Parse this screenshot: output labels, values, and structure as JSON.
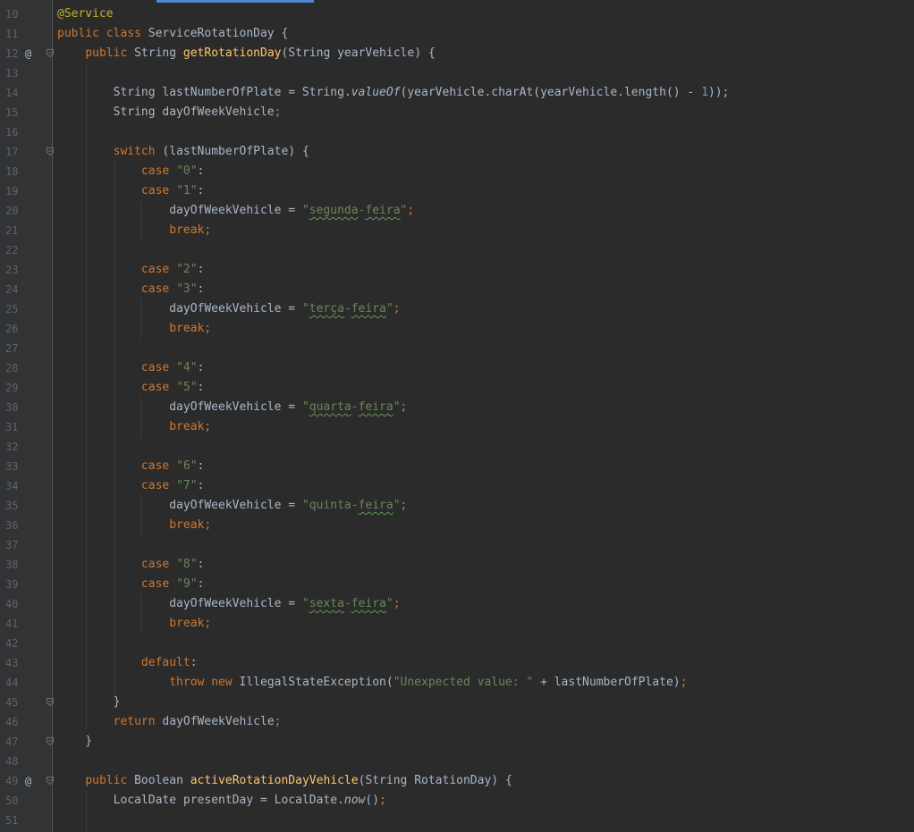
{
  "editor": {
    "lines": [
      {
        "n": "10",
        "segments": [
          {
            "t": "@Service",
            "c": "ann"
          }
        ]
      },
      {
        "n": "11",
        "segments": [
          {
            "t": "public class ",
            "c": "kw"
          },
          {
            "t": "ServiceRotationDay {",
            "c": ""
          }
        ]
      },
      {
        "n": "12",
        "icon": "@",
        "fold": true,
        "segments": [
          {
            "t": "    ",
            "c": ""
          },
          {
            "t": "public ",
            "c": "kw"
          },
          {
            "t": "String ",
            "c": ""
          },
          {
            "t": "getRotationDay",
            "c": "fn"
          },
          {
            "t": "(String yearVehicle) {",
            "c": ""
          }
        ]
      },
      {
        "n": "13",
        "segments": []
      },
      {
        "n": "14",
        "segments": [
          {
            "t": "        String lastNumberOfPlate = String.",
            "c": ""
          },
          {
            "t": "valueOf",
            "c": "ital"
          },
          {
            "t": "(yearVehicle.charAt(yearVehicle.length() - ",
            "c": ""
          },
          {
            "t": "1",
            "c": "num"
          },
          {
            "t": "));",
            "c": ""
          }
        ]
      },
      {
        "n": "15",
        "segments": [
          {
            "t": "        String dayOfWeekVehicle",
            "c": ""
          },
          {
            "t": ";",
            "c": "kw"
          }
        ]
      },
      {
        "n": "16",
        "segments": []
      },
      {
        "n": "17",
        "fold": true,
        "segments": [
          {
            "t": "        ",
            "c": ""
          },
          {
            "t": "switch ",
            "c": "kw"
          },
          {
            "t": "(lastNumberOfPlate) {",
            "c": ""
          }
        ]
      },
      {
        "n": "18",
        "segments": [
          {
            "t": "            ",
            "c": ""
          },
          {
            "t": "case ",
            "c": "kw"
          },
          {
            "t": "\"0\"",
            "c": "str"
          },
          {
            "t": ":",
            "c": ""
          }
        ]
      },
      {
        "n": "19",
        "segments": [
          {
            "t": "            ",
            "c": ""
          },
          {
            "t": "case ",
            "c": "kw"
          },
          {
            "t": "\"1\"",
            "c": "str"
          },
          {
            "t": ":",
            "c": ""
          }
        ]
      },
      {
        "n": "20",
        "segments": [
          {
            "t": "                dayOfWeekVehicle = ",
            "c": ""
          },
          {
            "t": "\"",
            "c": "str"
          },
          {
            "t": "segunda",
            "c": "str typo"
          },
          {
            "t": "-",
            "c": "str"
          },
          {
            "t": "feira",
            "c": "str typo"
          },
          {
            "t": "\"",
            "c": "str"
          },
          {
            "t": ";",
            "c": "kw"
          }
        ]
      },
      {
        "n": "21",
        "segments": [
          {
            "t": "                ",
            "c": ""
          },
          {
            "t": "break;",
            "c": "kw"
          }
        ]
      },
      {
        "n": "22",
        "segments": []
      },
      {
        "n": "23",
        "segments": [
          {
            "t": "            ",
            "c": ""
          },
          {
            "t": "case ",
            "c": "kw"
          },
          {
            "t": "\"2\"",
            "c": "str"
          },
          {
            "t": ":",
            "c": ""
          }
        ]
      },
      {
        "n": "24",
        "segments": [
          {
            "t": "            ",
            "c": ""
          },
          {
            "t": "case ",
            "c": "kw"
          },
          {
            "t": "\"3\"",
            "c": "str"
          },
          {
            "t": ":",
            "c": ""
          }
        ]
      },
      {
        "n": "25",
        "segments": [
          {
            "t": "                dayOfWeekVehicle = ",
            "c": ""
          },
          {
            "t": "\"",
            "c": "str"
          },
          {
            "t": "terça",
            "c": "str typo"
          },
          {
            "t": "-",
            "c": "str"
          },
          {
            "t": "feira",
            "c": "str typo"
          },
          {
            "t": "\"",
            "c": "str"
          },
          {
            "t": ";",
            "c": "kw"
          }
        ]
      },
      {
        "n": "26",
        "segments": [
          {
            "t": "                ",
            "c": ""
          },
          {
            "t": "break;",
            "c": "kw"
          }
        ]
      },
      {
        "n": "27",
        "segments": []
      },
      {
        "n": "28",
        "segments": [
          {
            "t": "            ",
            "c": ""
          },
          {
            "t": "case ",
            "c": "kw"
          },
          {
            "t": "\"4\"",
            "c": "str"
          },
          {
            "t": ":",
            "c": ""
          }
        ]
      },
      {
        "n": "29",
        "segments": [
          {
            "t": "            ",
            "c": ""
          },
          {
            "t": "case ",
            "c": "kw"
          },
          {
            "t": "\"5\"",
            "c": "str"
          },
          {
            "t": ":",
            "c": ""
          }
        ]
      },
      {
        "n": "30",
        "segments": [
          {
            "t": "                dayOfWeekVehicle = ",
            "c": ""
          },
          {
            "t": "\"",
            "c": "str"
          },
          {
            "t": "quarta",
            "c": "str typo"
          },
          {
            "t": "-",
            "c": "str"
          },
          {
            "t": "feira",
            "c": "str typo"
          },
          {
            "t": "\"",
            "c": "str"
          },
          {
            "t": ";",
            "c": "kw"
          }
        ]
      },
      {
        "n": "31",
        "segments": [
          {
            "t": "                ",
            "c": ""
          },
          {
            "t": "break;",
            "c": "kw"
          }
        ]
      },
      {
        "n": "32",
        "segments": []
      },
      {
        "n": "33",
        "segments": [
          {
            "t": "            ",
            "c": ""
          },
          {
            "t": "case ",
            "c": "kw"
          },
          {
            "t": "\"6\"",
            "c": "str"
          },
          {
            "t": ":",
            "c": ""
          }
        ]
      },
      {
        "n": "34",
        "segments": [
          {
            "t": "            ",
            "c": ""
          },
          {
            "t": "case ",
            "c": "kw"
          },
          {
            "t": "\"7\"",
            "c": "str"
          },
          {
            "t": ":",
            "c": ""
          }
        ]
      },
      {
        "n": "35",
        "segments": [
          {
            "t": "                dayOfWeekVehicle = ",
            "c": ""
          },
          {
            "t": "\"quinta-",
            "c": "str"
          },
          {
            "t": "feira",
            "c": "str typo"
          },
          {
            "t": "\"",
            "c": "str"
          },
          {
            "t": ";",
            "c": "kw"
          }
        ]
      },
      {
        "n": "36",
        "segments": [
          {
            "t": "                ",
            "c": ""
          },
          {
            "t": "break;",
            "c": "kw"
          }
        ]
      },
      {
        "n": "37",
        "segments": []
      },
      {
        "n": "38",
        "segments": [
          {
            "t": "            ",
            "c": ""
          },
          {
            "t": "case ",
            "c": "kw"
          },
          {
            "t": "\"8\"",
            "c": "str"
          },
          {
            "t": ":",
            "c": ""
          }
        ]
      },
      {
        "n": "39",
        "segments": [
          {
            "t": "            ",
            "c": ""
          },
          {
            "t": "case ",
            "c": "kw"
          },
          {
            "t": "\"9\"",
            "c": "str"
          },
          {
            "t": ":",
            "c": ""
          }
        ]
      },
      {
        "n": "40",
        "segments": [
          {
            "t": "                dayOfWeekVehicle = ",
            "c": ""
          },
          {
            "t": "\"",
            "c": "str"
          },
          {
            "t": "sexta",
            "c": "str typo"
          },
          {
            "t": "-",
            "c": "str"
          },
          {
            "t": "feira",
            "c": "str typo"
          },
          {
            "t": "\"",
            "c": "str"
          },
          {
            "t": ";",
            "c": "kw"
          }
        ]
      },
      {
        "n": "41",
        "segments": [
          {
            "t": "                ",
            "c": ""
          },
          {
            "t": "break;",
            "c": "kw"
          }
        ]
      },
      {
        "n": "42",
        "segments": []
      },
      {
        "n": "43",
        "segments": [
          {
            "t": "            ",
            "c": ""
          },
          {
            "t": "default",
            "c": "kw"
          },
          {
            "t": ":",
            "c": ""
          }
        ]
      },
      {
        "n": "44",
        "segments": [
          {
            "t": "                ",
            "c": ""
          },
          {
            "t": "throw new ",
            "c": "kw"
          },
          {
            "t": "IllegalStateException(",
            "c": ""
          },
          {
            "t": "\"Unexpected value: \" ",
            "c": "str"
          },
          {
            "t": "+ lastNumberOfPlate)",
            "c": ""
          },
          {
            "t": ";",
            "c": "kw"
          }
        ]
      },
      {
        "n": "45",
        "fold": true,
        "segments": [
          {
            "t": "        }",
            "c": ""
          }
        ]
      },
      {
        "n": "46",
        "segments": [
          {
            "t": "        ",
            "c": ""
          },
          {
            "t": "return ",
            "c": "kw"
          },
          {
            "t": "dayOfWeekVehicle",
            "c": ""
          },
          {
            "t": ";",
            "c": "kw"
          }
        ]
      },
      {
        "n": "47",
        "fold": true,
        "segments": [
          {
            "t": "    }",
            "c": ""
          }
        ]
      },
      {
        "n": "48",
        "segments": []
      },
      {
        "n": "49",
        "icon": "@",
        "fold": true,
        "segments": [
          {
            "t": "    ",
            "c": ""
          },
          {
            "t": "public ",
            "c": "kw"
          },
          {
            "t": "Boolean ",
            "c": ""
          },
          {
            "t": "activeRotationDayVehicle",
            "c": "fn"
          },
          {
            "t": "(String RotationDay) {",
            "c": ""
          }
        ]
      },
      {
        "n": "50",
        "segments": [
          {
            "t": "        LocalDate presentDay = LocalDate.",
            "c": ""
          },
          {
            "t": "now",
            "c": "ital"
          },
          {
            "t": "()",
            "c": ""
          },
          {
            "t": ";",
            "c": "kw"
          }
        ]
      },
      {
        "n": "51",
        "segments": []
      }
    ]
  },
  "colors": {
    "background": "#2b2b2b",
    "gutter": "#313335",
    "keyword": "#cc7832",
    "annotation": "#bbb529",
    "method": "#ffc66d",
    "string": "#6a8759",
    "number": "#6897bb",
    "text": "#a9b7c6"
  }
}
